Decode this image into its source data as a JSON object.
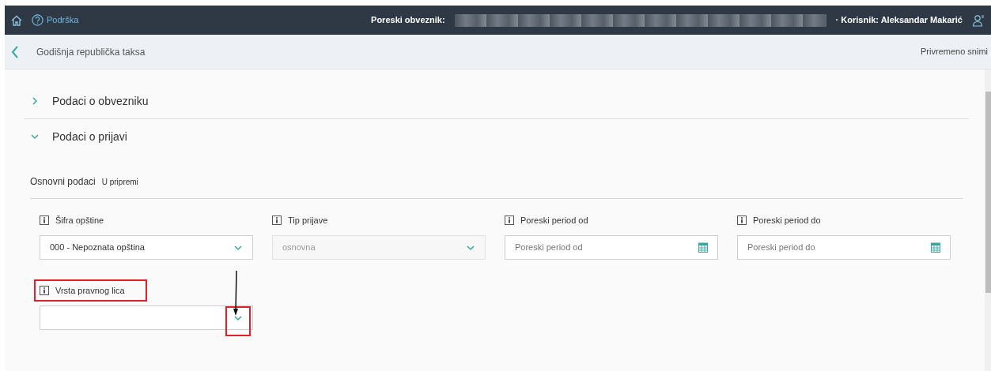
{
  "header": {
    "support_label": "Podrška",
    "taxpayer_label": "Poreski obveznik:",
    "user_label": "· Korisnik: Aleksandar Makarić"
  },
  "subheader": {
    "title": "Godišnja republička taksa",
    "save_button": "Privremeno snimi"
  },
  "sections": [
    {
      "title": "Podaci o obvezniku",
      "expanded": false
    },
    {
      "title": "Podaci o prijavi",
      "expanded": true
    }
  ],
  "subsection": {
    "title": "Osnovni podaci",
    "status": "U pripremi"
  },
  "fields": [
    {
      "label": "Šifra opštine",
      "kind": "select",
      "value": "000 - Nepoznata opština",
      "disabled": false
    },
    {
      "label": "Tip prijave",
      "kind": "select",
      "value": "osnovna",
      "disabled": true
    },
    {
      "label": "Poreski period od",
      "kind": "date",
      "placeholder": "Poreski period od",
      "disabled": false
    },
    {
      "label": "Poreski period do",
      "kind": "date",
      "placeholder": "Poreski period do",
      "disabled": false
    }
  ],
  "legal_entity_field": {
    "label": "Vrsta pravnog lica",
    "kind": "select",
    "disabled": false,
    "highlighted": true
  }
}
